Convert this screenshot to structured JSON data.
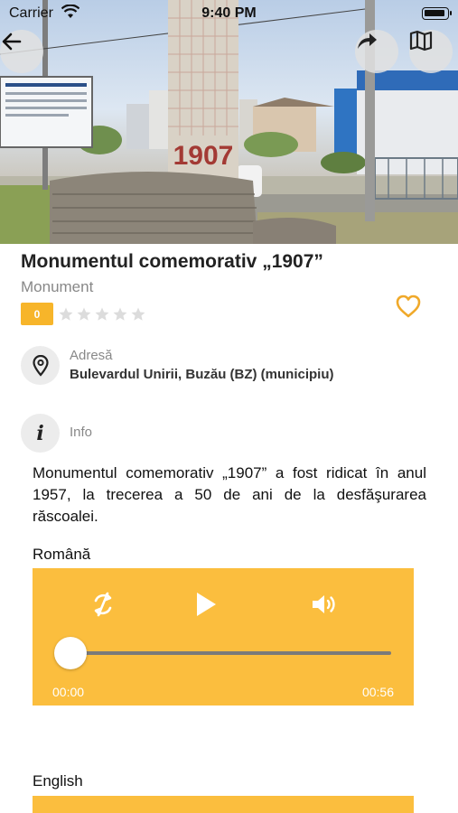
{
  "status_bar": {
    "carrier": "Carrier",
    "time": "9:40 PM"
  },
  "hero": {
    "plaque_text": "1907"
  },
  "header": {
    "back_icon": "arrow-left-icon",
    "share_icon": "share-arrow-icon",
    "map_icon": "map-icon"
  },
  "place": {
    "title": "Monumentul comemorativ „1907”",
    "category": "Monument",
    "rating_value": "0",
    "rating_stars_total": 5,
    "favorite_icon": "heart-outline-icon"
  },
  "address": {
    "icon": "location-pin-icon",
    "label": "Adresă",
    "value": "Bulevardul Unirii, Buzău (BZ) (municipiu)"
  },
  "info": {
    "icon": "info-icon",
    "label": "Info",
    "glyph": "i",
    "description": "Monumentul comemorativ „1907” a fost ridicat în anul 1957, la trecerea a 50 de ani de la desfăşurarea răscoalei."
  },
  "audio_romana": {
    "language": "Română",
    "current_time": "00:00",
    "duration": "00:56",
    "progress": 0
  },
  "audio_english": {
    "language": "English"
  },
  "colors": {
    "accent": "#fbbe3e",
    "badge": "#f7b52a",
    "heart": "#f0a92a"
  }
}
